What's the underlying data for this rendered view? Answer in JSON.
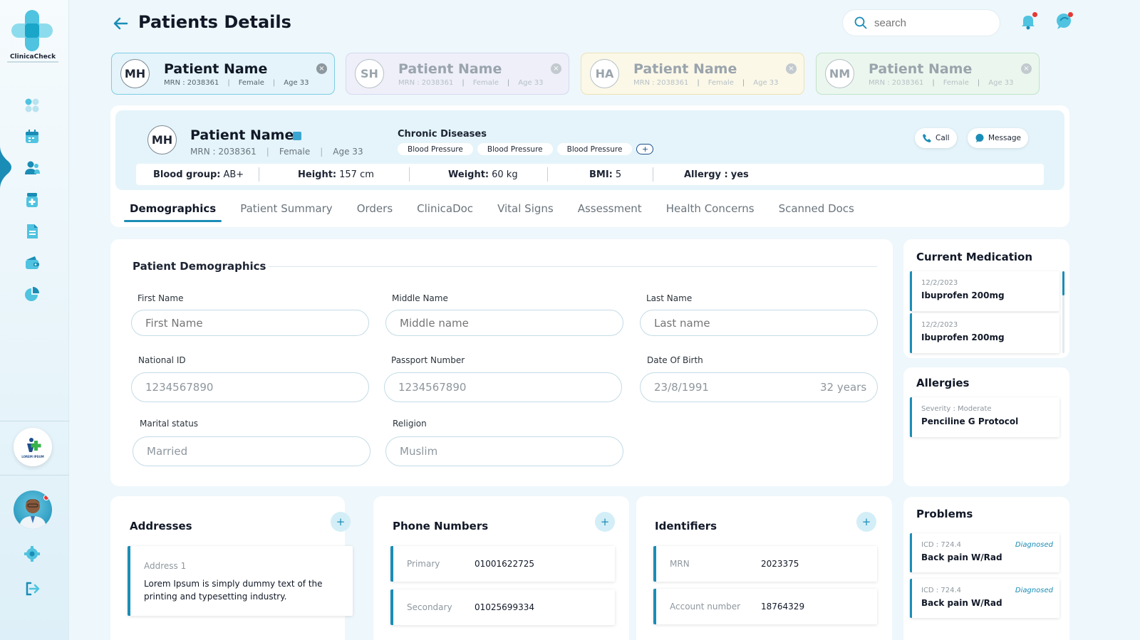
{
  "app": {
    "logo_text": "ClinicaCheck",
    "org_logo_text": "LOREM IPSUM"
  },
  "colors": {
    "accent": "#1a8db6",
    "tab1": "#e4f4fa",
    "tab2": "#eeeff9",
    "tab3": "#fbf8e8",
    "tab4": "#ebf7ee"
  },
  "sidebar": {
    "items": [
      {
        "name": "dashboard-icon"
      },
      {
        "name": "calendar-icon"
      },
      {
        "name": "patients-icon"
      },
      {
        "name": "medication-icon"
      },
      {
        "name": "document-icon"
      },
      {
        "name": "wallet-icon"
      },
      {
        "name": "pie-chart-icon"
      }
    ],
    "bottom": [
      {
        "name": "settings-icon"
      },
      {
        "name": "logout-icon"
      }
    ]
  },
  "header": {
    "title": "Patients Details",
    "search_placeholder": "search"
  },
  "patient_tabs": [
    {
      "initials": "MH",
      "name": "Patient Name",
      "mrn": "MRN : 2038361",
      "gender": "Female",
      "age": "Age 33"
    },
    {
      "initials": "SH",
      "name": "Patient Name",
      "mrn": "MRN : 2038361",
      "gender": "Female",
      "age": "Age 33"
    },
    {
      "initials": "HA",
      "name": "Patient Name",
      "mrn": "MRN : 2038361",
      "gender": "Female",
      "age": "Age 33"
    },
    {
      "initials": "NM",
      "name": "Patient Name",
      "mrn": "MRN : 2038361",
      "gender": "Female",
      "age": "Age 33"
    }
  ],
  "patient": {
    "initials": "MH",
    "name": "Patient Name",
    "mrn": "MRN : 2038361",
    "gender": "Female",
    "age": "Age 33",
    "chronic_title": "Chronic Diseases",
    "chronic": [
      "Blood Pressure",
      "Blood Pressure",
      "Blood Pressure"
    ],
    "chronic_add": "+",
    "call_label": "Call",
    "message_label": "Message",
    "vitals": [
      {
        "label": "Blood group:",
        "value": "AB+"
      },
      {
        "label": "Height:",
        "value": "157 cm"
      },
      {
        "label": "Weight:",
        "value": "60 kg"
      },
      {
        "label": "BMI:",
        "value": "5"
      },
      {
        "label": "Allergy :",
        "value": "yes"
      }
    ]
  },
  "tabs": [
    "Demographics",
    "Patient Summary",
    "Orders",
    "ClinicaDoc",
    "Vital Signs",
    "Assessment",
    "Health Concerns",
    "Scanned Docs"
  ],
  "demographics": {
    "title": "Patient Demographics",
    "fields": {
      "first_name": {
        "label": "First Name",
        "placeholder": "First Name"
      },
      "middle_name": {
        "label": "Middle Name",
        "placeholder": "Middle name"
      },
      "last_name": {
        "label": "Last Name",
        "placeholder": "Last name"
      },
      "national_id": {
        "label": "National ID",
        "value": "1234567890"
      },
      "passport": {
        "label": "Passport Number",
        "value": "1234567890"
      },
      "dob": {
        "label": "Date Of Birth",
        "value": "23/8/1991",
        "suffix": "32 years"
      },
      "marital": {
        "label": "Marital status",
        "value": "Married"
      },
      "religion": {
        "label": "Religion",
        "value": "Muslim"
      }
    }
  },
  "current_medication": {
    "title": "Current Medication",
    "items": [
      {
        "date": "12/2/2023",
        "drug": "Ibuprofen 200mg"
      },
      {
        "date": "12/2/2023",
        "drug": "Ibuprofen 200mg"
      }
    ]
  },
  "allergies": {
    "title": "Allergies",
    "items": [
      {
        "severity": "Severity : Moderate",
        "name": "Penciline G Protocol"
      }
    ]
  },
  "problems": {
    "title": "Problems",
    "items": [
      {
        "icd": "ICD : 724.4",
        "status": "Diagnosed",
        "name": "Back pain W/Rad"
      },
      {
        "icd": "ICD : 724.4",
        "status": "Diagnosed",
        "name": "Back pain W/Rad"
      }
    ]
  },
  "addresses": {
    "title": "Addresses",
    "items": [
      {
        "label": "Address 1",
        "text": "Lorem Ipsum is simply dummy text of the printing and typesetting industry."
      }
    ]
  },
  "phones": {
    "title": "Phone Numbers",
    "items": [
      {
        "label": "Primary",
        "value": "01001622725"
      },
      {
        "label": "Secondary",
        "value": "01025699334"
      }
    ]
  },
  "identifiers": {
    "title": "Identifiers",
    "items": [
      {
        "label": "MRN",
        "value": "2023375"
      },
      {
        "label": "Account number",
        "value": "18764329"
      }
    ]
  },
  "add_label": "+",
  "close_label": "×"
}
